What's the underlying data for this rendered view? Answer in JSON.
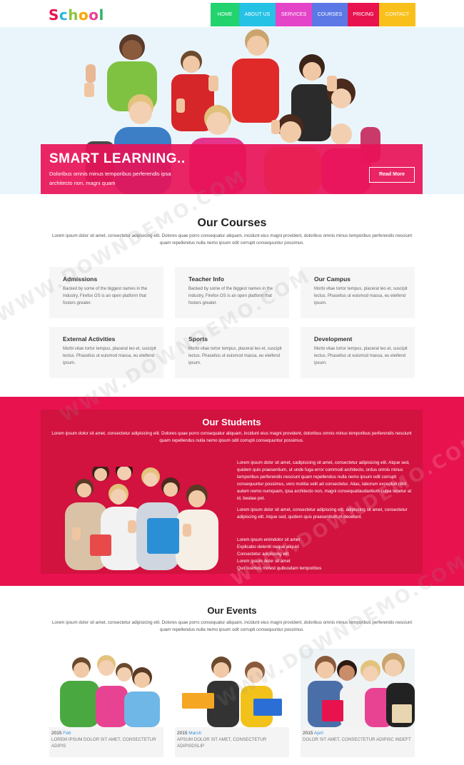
{
  "logo": {
    "text": "School",
    "letters": [
      {
        "ch": "S",
        "color": "#e8124f"
      },
      {
        "ch": "c",
        "color": "#26b5e6"
      },
      {
        "ch": "h",
        "color": "#8dc63f"
      },
      {
        "ch": "o",
        "color": "#f7a600"
      },
      {
        "ch": "o",
        "color": "#e84393"
      },
      {
        "ch": "l",
        "color": "#2fb36a"
      }
    ]
  },
  "nav": [
    {
      "label": "HOME",
      "color": "#22d36e",
      "width": 40
    },
    {
      "label": "ABOUT US",
      "color": "#26c2e6",
      "width": 51
    },
    {
      "label": "SERVICES",
      "color": "#e444c8",
      "width": 51
    },
    {
      "label": "COURSES",
      "color": "#5b78e6",
      "width": 50
    },
    {
      "label": "PRICING",
      "color": "#e8124f",
      "width": 44
    },
    {
      "label": "CONTACT",
      "color": "#f9c01b",
      "width": 51
    }
  ],
  "hero": {
    "title": "SMART LEARNING..",
    "text": "Doloribus omnis minus temporibus perferendis ipsa architecto non, magni quam",
    "button": "Read More"
  },
  "courses": {
    "title": "Our Courses",
    "desc": "Lorem ipsum dolor sit amet, consectetur adipisicing elit. Dolores quae porro consequatur aliquam, incidunt eius magni provident, doloribus omnis minus temporibus perferendis nesciunt quam repellendus nulla nemo ipsum odit corrupti consequuntur possimus.",
    "items": [
      {
        "title": "Admissions",
        "text": "Backed by some of the biggest names in the industry, Firefox OS is an open platform that fosters greater."
      },
      {
        "title": "Teacher Info",
        "text": "Backed by some of the biggest names in the industry, Firefox OS is an open platform that fosters greater."
      },
      {
        "title": "Our Campus",
        "text": "Morbi vitae tortor tempus, placerat leo et, suscipit lectus. Phasellus ut euismod massa, eu eleifend ipsum."
      },
      {
        "title": "External Activities",
        "text": "Morbi vitae tortor tempus, placerat leo et, suscipit lectus. Phasellus ut euismod massa, eu eleifend ipsum."
      },
      {
        "title": "Sports",
        "text": "Morbi vitae tortor tempus, placerat leo et, suscipit lectus. Phasellus ut euismod massa, eu eleifend ipsum."
      },
      {
        "title": "Development",
        "text": "Morbi vitae tortor tempus, placerat leo et, suscipit lectus. Phasellus ut euismod massa, eu eleifend ipsum."
      }
    ]
  },
  "students": {
    "title": "Our Students",
    "desc": "Lorem ipsum dolor sit amet, consectetur adipisicing elit. Dolores quae porro consequatur aliquam, incidunt eius magni provident, doloribus omnis minus temporibus perferendis nesciunt quam repellendus nulla nemo ipsum odit corrupti consequuntur possimus.",
    "para1": "Lorem ipsum dolor sit amet, cadipisicing sit amet, consectetur adipisicing elit. Atque sed, quidem quis praesentium, ut unde fuga error commodi architecto, laudantium culpa tenetur at id, beatae pet.",
    "para1b": "Lorem ipsum dolor sit amet, cadipisicing sit amet, consectetur adipisicing elit. Atque sed, quidem quis praesentium, ut unde fuga error commodi architecto, ordus omnis minus temporibus perferendis nesciunt quam repellendus nulla nemo ipsum odit corrupti consequuntur possimus, vero molitia velit ad consectetur. Alias, laborum excepturi nihil autem nemo numquam, ipsa architecto non, magni consequatlaudantium culpa tenetur at id, beatae pet.",
    "para2": "Lorem ipsum dolor sit amet, consectetur adipiscing elit, adipiscing sit amet, consectetur adipiscing elit. Atque sed, quidem quis praesentium,m deserunt.",
    "list": [
      "Lorem ipsum enimdolor sit amet",
      "Explicabo deleniti neque aliquid",
      "Consectetur adipiscing elit",
      "Lorem ipsum dolor sit amet",
      "Quo issimos molest quibusdam temporibus"
    ]
  },
  "events": {
    "title": "Our Events",
    "desc": "Lorem ipsum dolor sit amet, consectetur adipisicing elit. Dolores quae porro consequatur aliquam, incidunt eius magni provident, doloribus omnis minus temporibus perferendis nesciunt quam repellendus nulla nemo ipsum odit corrupti consequuntur possimus.",
    "items": [
      {
        "year": "2015",
        "month": "Feb",
        "text": "LOREM IPSUM DOLOR SIT AMET, CONSECTETUR ADIPIS"
      },
      {
        "year": "2015",
        "month": "March",
        "text": "APSUM DOLOR SIT AMET, CONSECTETUR ADIPISDSLIP"
      },
      {
        "year": "2015",
        "month": "April",
        "text": "DOLOR SIT AMET, CONSECTETUR ADIPISC INDEFT"
      }
    ]
  },
  "watermark": "WWW.DOWNDEMO.COM",
  "colors": {
    "accent": "#e8124f",
    "hero_bg": "#e8f4fa"
  }
}
